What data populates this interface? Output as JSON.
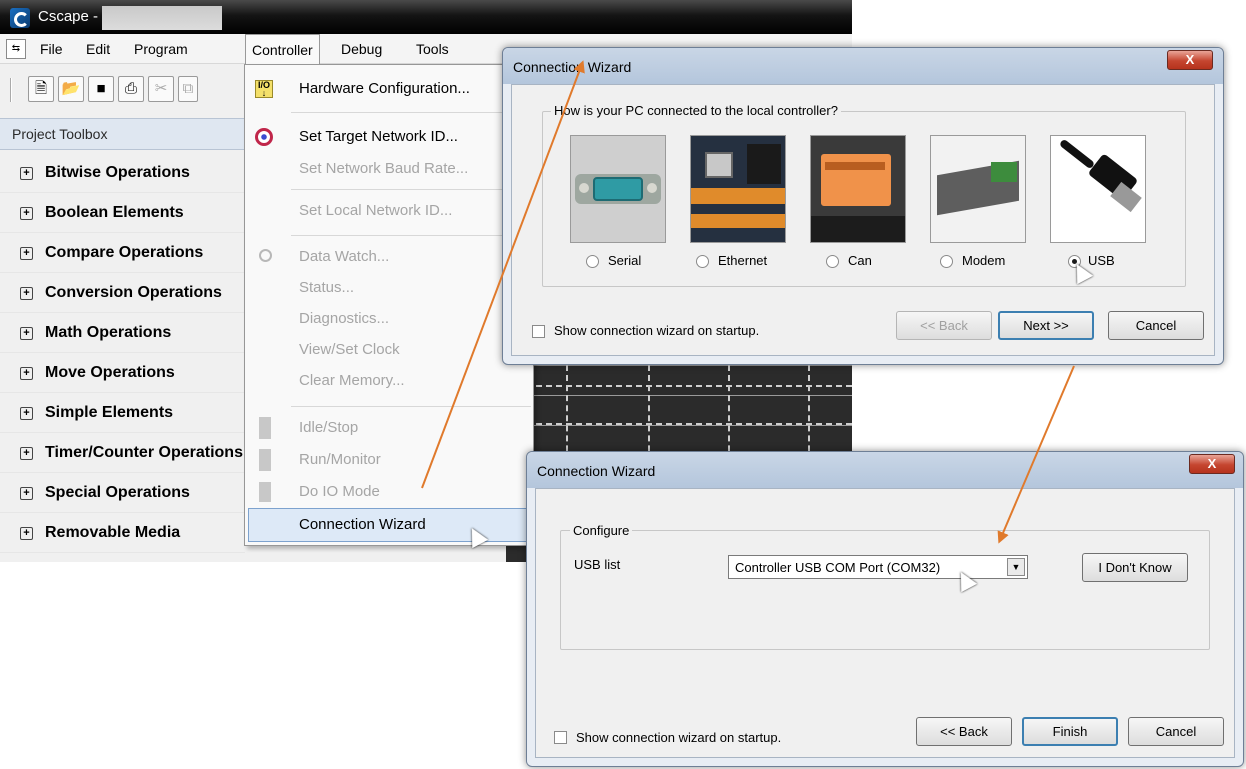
{
  "app": {
    "title": "Cscape -",
    "menubar": {
      "file": "File",
      "edit": "Edit",
      "program": "Program",
      "controller": "Controller",
      "debug": "Debug",
      "tools": "Tools"
    },
    "toolbox": {
      "header": "Project Toolbox",
      "items": [
        "Bitwise Operations",
        "Boolean Elements",
        "Compare Operations",
        "Conversion Operations",
        "Math Operations",
        "Move Operations",
        "Simple Elements",
        "Timer/Counter Operations",
        "Special Operations",
        "Removable Media"
      ]
    }
  },
  "controller_menu": {
    "items": [
      {
        "label": "Hardware Configuration...",
        "enabled": true,
        "icon": "io-config-icon"
      },
      {
        "label": "Set Target Network ID...",
        "enabled": true,
        "icon": "target-icon"
      },
      {
        "label": "Set Network Baud Rate...",
        "enabled": false
      },
      {
        "label": "Set Local Network ID...",
        "enabled": false
      },
      {
        "label": "Data Watch...",
        "enabled": false,
        "icon": "magnifier-icon"
      },
      {
        "label": "Status...",
        "enabled": false
      },
      {
        "label": "Diagnostics...",
        "enabled": false
      },
      {
        "label": "View/Set Clock",
        "enabled": false
      },
      {
        "label": "Clear Memory...",
        "enabled": false
      },
      {
        "label": "Idle/Stop",
        "enabled": false,
        "icon": "idle-icon"
      },
      {
        "label": "Run/Monitor",
        "enabled": false,
        "icon": "run-icon"
      },
      {
        "label": "Do IO Mode",
        "enabled": false,
        "icon": "io-mode-icon"
      },
      {
        "label": "Connection Wizard",
        "enabled": true,
        "highlighted": true
      }
    ]
  },
  "wizard1": {
    "title": "Connection Wizard",
    "close": "X",
    "group_label": "How is your PC connected to the local controller?",
    "options": [
      {
        "label": "Serial",
        "selected": false
      },
      {
        "label": "Ethernet",
        "selected": false
      },
      {
        "label": "Can",
        "selected": false
      },
      {
        "label": "Modem",
        "selected": false
      },
      {
        "label": "USB",
        "selected": true
      }
    ],
    "startup_checkbox": "Show connection wizard on startup.",
    "startup_checked": false,
    "back": "<< Back",
    "next": "Next >>",
    "cancel": "Cancel"
  },
  "wizard2": {
    "title": "Connection Wizard",
    "close": "X",
    "group_label": "Configure",
    "usb_list_label": "USB list",
    "usb_list_value": "Controller USB COM Port (COM32)",
    "dont_know": "I Don't Know",
    "startup_checkbox": "Show connection wizard on startup.",
    "startup_checked": false,
    "back": "<< Back",
    "finish": "Finish",
    "cancel": "Cancel"
  },
  "colors": {
    "annotation_arrow": "#e07a2c",
    "menu_highlight": "#dde9f7",
    "dialog_title": "#b9cade"
  }
}
